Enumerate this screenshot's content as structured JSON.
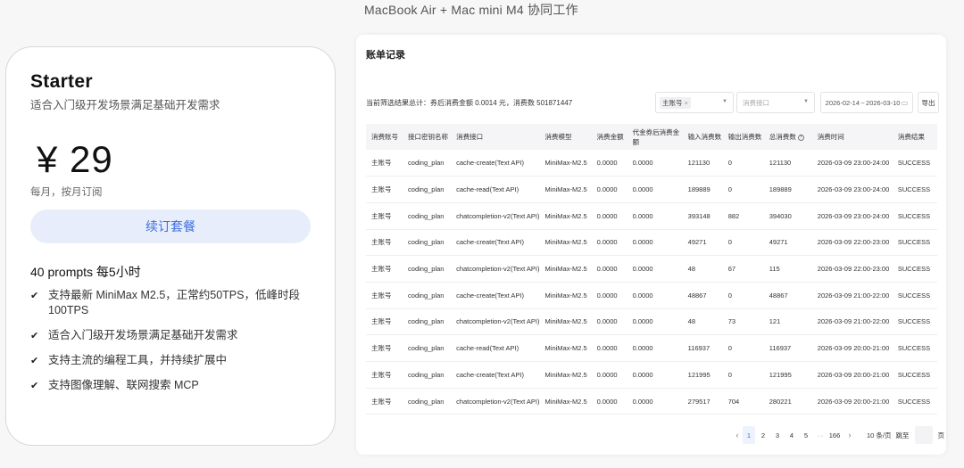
{
  "caption": "MacBook Air + Mac mini M4 协同工作",
  "plan": {
    "name": "Starter",
    "description": "适合入门级开发场景满足基础开发需求",
    "price": "¥ 29",
    "period": "每月，按月订阅",
    "renew_label": "续订套餐",
    "quota": "40 prompts 每5小时",
    "features": [
      "支持最新 MiniMax M2.5，正常约50TPS，低峰时段100TPS",
      "适合入门级开发场景满足基础开发需求",
      "支持主流的编程工具，并持续扩展中",
      "支持图像理解、联网搜索 MCP"
    ]
  },
  "billing": {
    "title": "账单记录",
    "summary": "当前筛选结果总计：券后消费金额 0.0014 元，消费数 501871447",
    "filters": {
      "account_tag": "主账号",
      "api_placeholder": "消费接口",
      "date_start": "2026-02-14",
      "date_sep": "~",
      "date_end": "2026-03-10"
    },
    "export_label": "导出",
    "columns": [
      "消费账号",
      "接口密钥名称",
      "消费接口",
      "消费模型",
      "消费金额",
      "代金券后消费金额",
      "输入消费数",
      "输出消费数",
      "总消费数",
      "消费时间",
      "消费结果"
    ],
    "rows": [
      [
        "主账号",
        "coding_plan",
        "cache-create(Text API)",
        "MiniMax-M2.5",
        "0.0000",
        "0.0000",
        "121130",
        "0",
        "121130",
        "2026-03-09 23:00-24:00",
        "SUCCESS"
      ],
      [
        "主账号",
        "coding_plan",
        "cache-read(Text API)",
        "MiniMax-M2.5",
        "0.0000",
        "0.0000",
        "189889",
        "0",
        "189889",
        "2026-03-09 23:00-24:00",
        "SUCCESS"
      ],
      [
        "主账号",
        "coding_plan",
        "chatcompletion-v2(Text API)",
        "MiniMax-M2.5",
        "0.0000",
        "0.0000",
        "393148",
        "882",
        "394030",
        "2026-03-09 23:00-24:00",
        "SUCCESS"
      ],
      [
        "主账号",
        "coding_plan",
        "cache-create(Text API)",
        "MiniMax-M2.5",
        "0.0000",
        "0.0000",
        "49271",
        "0",
        "49271",
        "2026-03-09 22:00-23:00",
        "SUCCESS"
      ],
      [
        "主账号",
        "coding_plan",
        "chatcompletion-v2(Text API)",
        "MiniMax-M2.5",
        "0.0000",
        "0.0000",
        "48",
        "67",
        "115",
        "2026-03-09 22:00-23:00",
        "SUCCESS"
      ],
      [
        "主账号",
        "coding_plan",
        "cache-create(Text API)",
        "MiniMax-M2.5",
        "0.0000",
        "0.0000",
        "48867",
        "0",
        "48867",
        "2026-03-09 21:00-22:00",
        "SUCCESS"
      ],
      [
        "主账号",
        "coding_plan",
        "chatcompletion-v2(Text API)",
        "MiniMax-M2.5",
        "0.0000",
        "0.0000",
        "48",
        "73",
        "121",
        "2026-03-09 21:00-22:00",
        "SUCCESS"
      ],
      [
        "主账号",
        "coding_plan",
        "cache-read(Text API)",
        "MiniMax-M2.5",
        "0.0000",
        "0.0000",
        "116937",
        "0",
        "116937",
        "2026-03-09 20:00-21:00",
        "SUCCESS"
      ],
      [
        "主账号",
        "coding_plan",
        "cache-create(Text API)",
        "MiniMax-M2.5",
        "0.0000",
        "0.0000",
        "121995",
        "0",
        "121995",
        "2026-03-09 20:00-21:00",
        "SUCCESS"
      ],
      [
        "主账号",
        "coding_plan",
        "chatcompletion-v2(Text API)",
        "MiniMax-M2.5",
        "0.0000",
        "0.0000",
        "279517",
        "704",
        "280221",
        "2026-03-09 20:00-21:00",
        "SUCCESS"
      ]
    ],
    "pagination": {
      "prev": "‹",
      "pages": [
        "1",
        "2",
        "3",
        "4",
        "5"
      ],
      "active_page": "1",
      "ellipsis": "···",
      "last_page": "166",
      "next": "›",
      "page_size": "10 条/页",
      "jump_label": "跳至",
      "page_unit": "页"
    }
  },
  "icons": {
    "check": "check-icon",
    "caret": "chevron-down-icon",
    "calendar": "calendar-icon",
    "help": "help-circle-icon"
  },
  "colors": {
    "accent": "#3c6fe0",
    "button_bg": "#e7edfb",
    "page_bg": "#f7f7f8"
  }
}
